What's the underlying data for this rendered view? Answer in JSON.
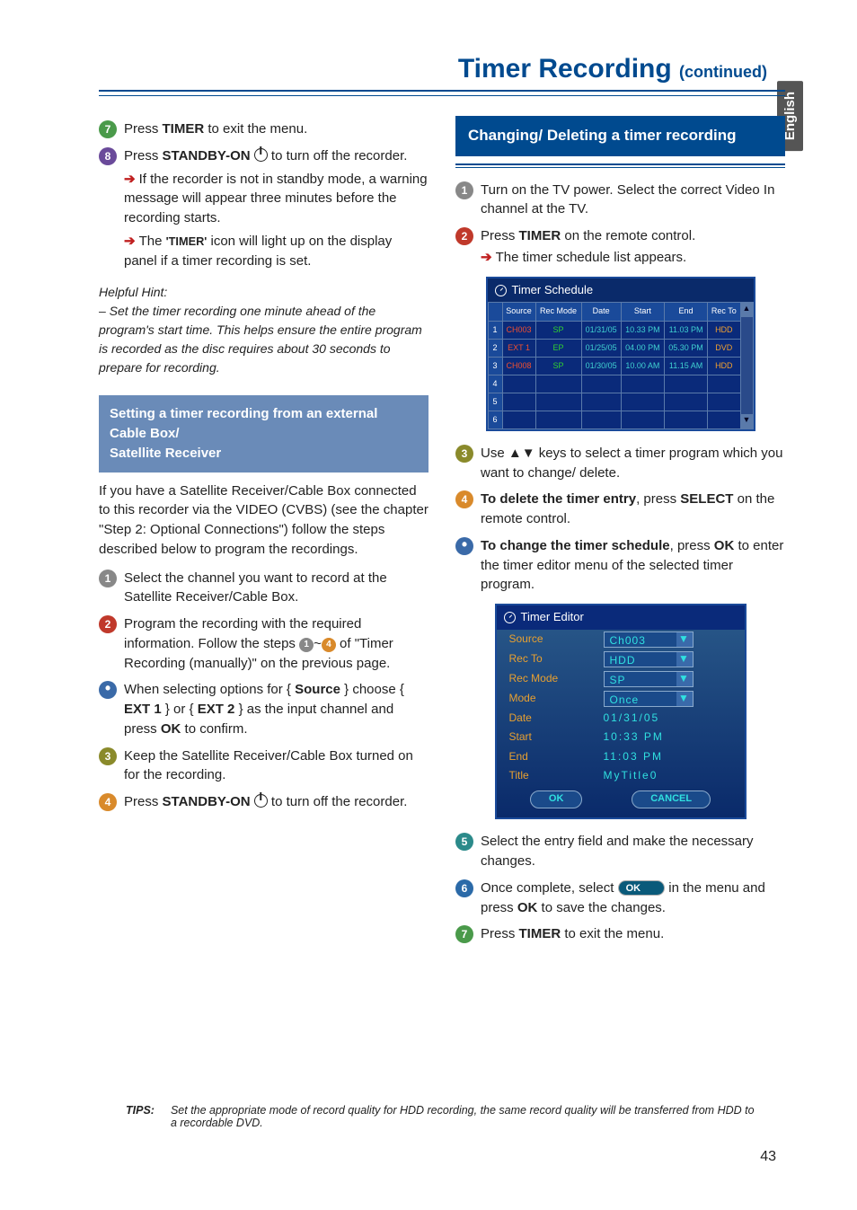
{
  "sideTab": "English",
  "title": {
    "main": "Timer Recording ",
    "sub": "(continued)"
  },
  "left": {
    "s7": {
      "a": "Press ",
      "b": "TIMER",
      "c": " to exit the menu."
    },
    "s8": {
      "a": "Press ",
      "b": "STANDBY-ON",
      "c": " to turn off the recorder."
    },
    "s8_sub1": "If the recorder is not in standby mode, a warning message will appear three minutes before the recording starts.",
    "s8_sub2a": "The ",
    "s8_sub2b": "'TIMER'",
    "s8_sub2c": " icon will light up on the display panel if a timer recording is set.",
    "hintTitle": "Helpful Hint:",
    "hintBody": "– Set the timer recording one minute ahead of the program's start time. This helps ensure the entire program is recorded as the disc requires about 30 seconds to prepare for recording.",
    "calloutTitle": "Setting a timer recording from an external Cable Box/\nSatellite Receiver",
    "calloutBody": "If you have a Satellite Receiver/Cable Box connected to this recorder via the VIDEO (CVBS) (see the chapter \"Step 2: Optional Connections\") follow the steps described below to program the recordings.",
    "cs1": "Select the channel you want to record at the Satellite Receiver/Cable Box.",
    "cs2a": "Program the recording with the required information. Follow the steps ",
    "cs2b": " of \"Timer Recording (manually)\" on the previous page.",
    "cs2note_a": "When selecting options for { ",
    "cs2note_b": "Source",
    "cs2note_c": " } choose { ",
    "cs2note_d": "EXT 1",
    "cs2note_e": " } or { ",
    "cs2note_f": "EXT 2",
    "cs2note_g": " } as the input channel and press ",
    "cs2note_h": "OK",
    "cs2note_i": " to confirm.",
    "cs3": "Keep the Satellite Receiver/Cable Box turned on for the recording.",
    "cs4a": "Press ",
    "cs4b": "STANDBY-ON",
    "cs4c": " to turn off the recorder."
  },
  "right": {
    "headTitle": "Changing/ Deleting a timer recording",
    "r1": "Turn on the TV power. Select the correct Video In channel at the TV.",
    "r2a": "Press ",
    "r2b": "TIMER",
    "r2c": " on the remote control.",
    "r2sub": "The timer schedule list appears.",
    "scheduleTitle": "Timer Schedule",
    "scheduleHeaders": [
      "",
      "Source",
      "Rec Mode",
      "Date",
      "Start",
      "End",
      "Rec To"
    ],
    "scheduleRows": [
      {
        "n": "1",
        "source": "CH003",
        "mode": "SP",
        "date": "01/31/05",
        "start": "10.33 PM",
        "end": "11.03 PM",
        "to": "HDD"
      },
      {
        "n": "2",
        "source": "EXT 1",
        "mode": "EP",
        "date": "01/25/05",
        "start": "04.00 PM",
        "end": "05.30 PM",
        "to": "DVD"
      },
      {
        "n": "3",
        "source": "CH008",
        "mode": "SP",
        "date": "01/30/05",
        "start": "10.00 AM",
        "end": "11.15 AM",
        "to": "HDD"
      },
      {
        "n": "4",
        "source": "",
        "mode": "",
        "date": "",
        "start": "",
        "end": "",
        "to": ""
      },
      {
        "n": "5",
        "source": "",
        "mode": "",
        "date": "",
        "start": "",
        "end": "",
        "to": ""
      },
      {
        "n": "6",
        "source": "",
        "mode": "",
        "date": "",
        "start": "",
        "end": "",
        "to": ""
      }
    ],
    "r3a": "Use ",
    "r3b": " keys to select a timer program which you want to change/ delete.",
    "r4a": "To delete the timer entry",
    "r4b": ", press ",
    "r4c": "SELECT",
    "r4d": " on the remote control.",
    "r5a": "To change the timer schedule",
    "r5b": ", press ",
    "r5c": "OK",
    "r5d": " to enter the timer editor menu of the selected timer program.",
    "editorTitle": "Timer Editor",
    "editorRows": [
      {
        "label": "Source",
        "value": "Ch003",
        "dd": true
      },
      {
        "label": "Rec To",
        "value": "HDD",
        "dd": true
      },
      {
        "label": "Rec Mode",
        "value": "SP",
        "dd": true
      },
      {
        "label": "Mode",
        "value": "Once",
        "dd": true
      },
      {
        "label": "Date",
        "value": "01/31/05",
        "dd": false
      },
      {
        "label": "Start",
        "value": "10:33 PM",
        "dd": false
      },
      {
        "label": "End",
        "value": "11:03 PM",
        "dd": false
      },
      {
        "label": "Title",
        "value": "MyTitle0",
        "dd": false
      }
    ],
    "editorOk": "OK",
    "editorCancel": "CANCEL",
    "r6": "Select the entry field and make the necessary changes.",
    "r7a": "Once complete, select ",
    "r7b": " in the menu and press ",
    "r7c": "OK",
    "r7d": " to save the changes.",
    "r8a": "Press ",
    "r8b": "TIMER",
    "r8c": " to exit the menu.",
    "okBtn": "OK"
  },
  "tips": {
    "label": "TIPS:",
    "body": "Set the appropriate mode of record quality for HDD recording, the same record quality will be transferred from HDD to a recordable DVD."
  },
  "pageNum": "43"
}
